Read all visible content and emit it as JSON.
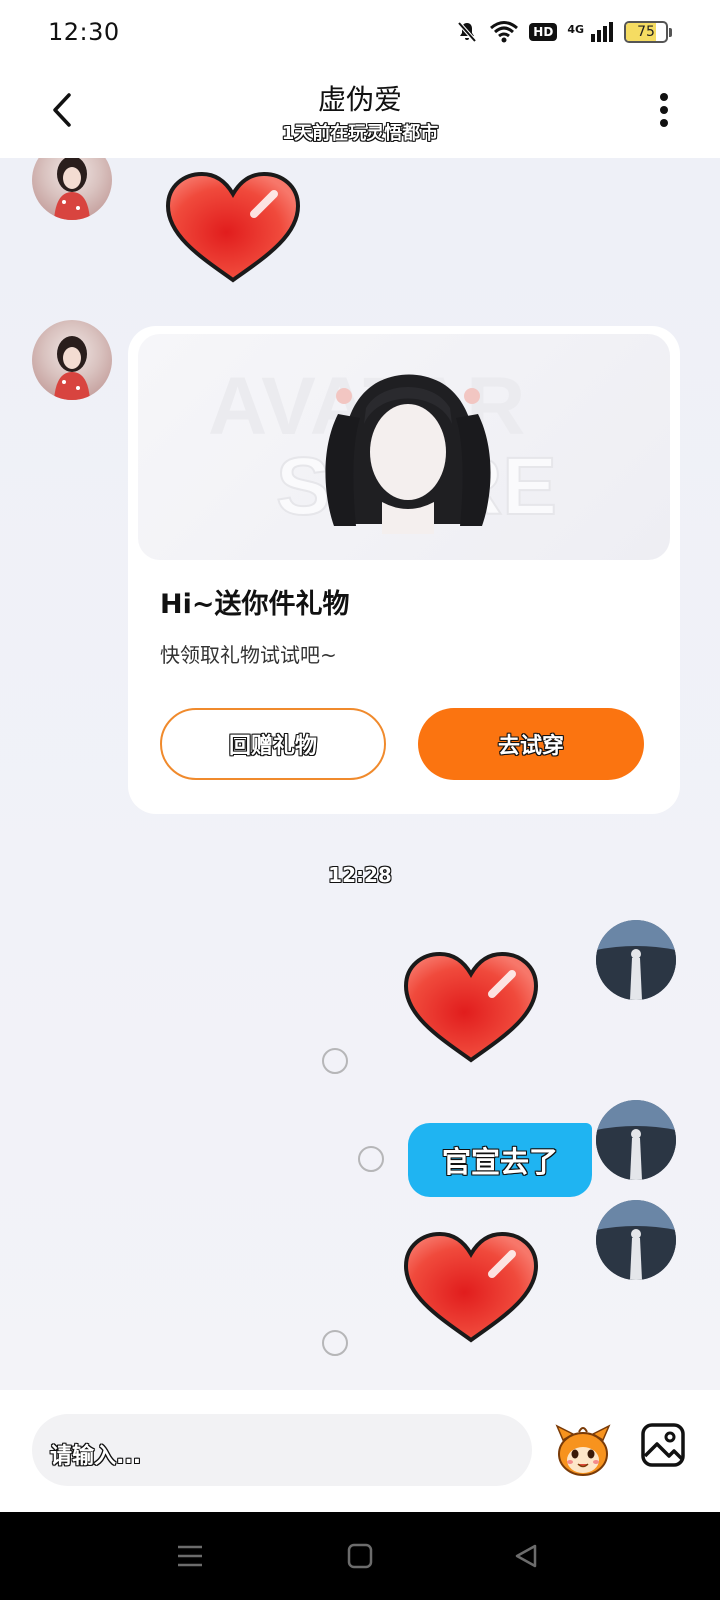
{
  "status_bar": {
    "time": "12:30",
    "network_label": "4G",
    "hd_label": "HD",
    "battery_level": "75",
    "icons": [
      "bell-muted-icon",
      "wifi-icon",
      "hd-icon",
      "signal-icon",
      "battery-icon"
    ]
  },
  "header": {
    "title": "虚伪爱",
    "subtitle": "1天前在玩灵悟都市",
    "icons": [
      "chevron-left-icon",
      "more-vertical-icon"
    ]
  },
  "messages": {
    "gift_card": {
      "title": "Hi~送你件礼物",
      "description": "快领取礼物试试吧~",
      "return_gift_label": "回赠礼物",
      "try_on_label": "去试穿"
    },
    "timestamp": "12:28",
    "text_message": "官宣去了"
  },
  "input": {
    "placeholder": "请输入..."
  },
  "colors": {
    "accent_orange": "#fb7410",
    "bubble_blue": "#1fb4f2",
    "heart_red": "#e8322a",
    "background": "#f2f3f8"
  }
}
